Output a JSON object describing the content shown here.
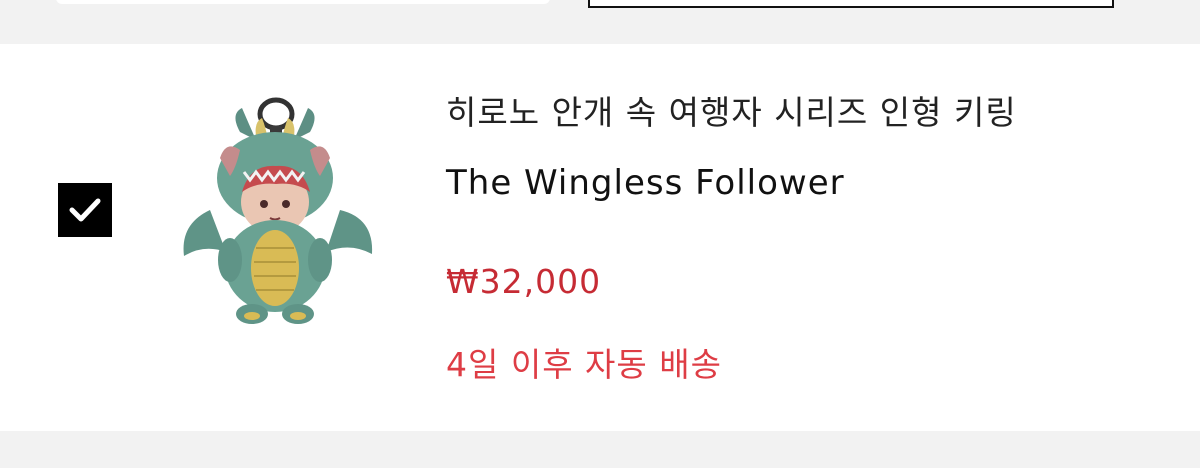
{
  "item": {
    "checked": true,
    "title_ko": "히로노 안개 속 여행자 시리즈 인형 키링",
    "title_en": "The Wingless Follower",
    "price": "₩32,000",
    "delivery_note": "4일 이후 자동 배송",
    "price_color": "#c62b34",
    "delivery_color": "#de3d45"
  },
  "icons": {
    "checkbox": "checkmark-icon"
  }
}
